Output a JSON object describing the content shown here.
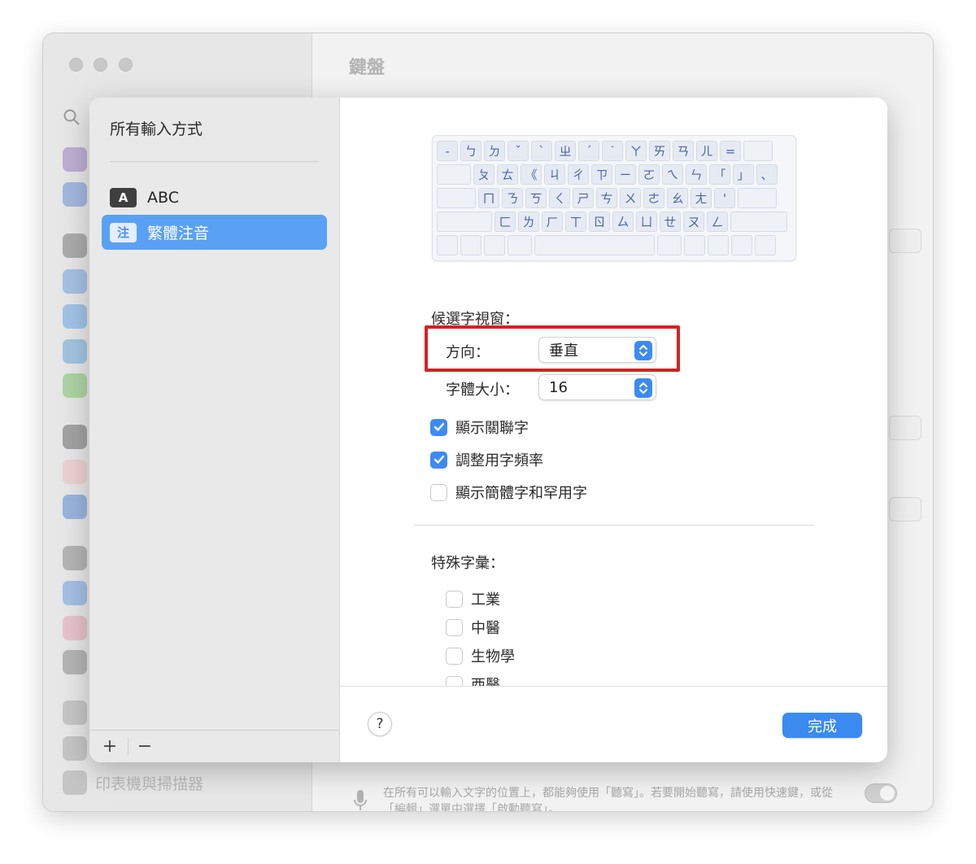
{
  "background_window": {
    "title": "鍵盤",
    "printer_label": "印表機與掃描器",
    "footnote": "在所有可以輸入文字的位置上，都能夠使用「聽寫」。若要開始聽寫，請使用快速鍵，或從「編輯」選單中選擇「啟動聽寫」。"
  },
  "sidebar": {
    "title": "所有輸入方式",
    "items": [
      {
        "badge": "A",
        "label": "ABC",
        "selected": false
      },
      {
        "badge": "注",
        "label": "繁體注音",
        "selected": true
      }
    ],
    "add_label": "+",
    "remove_label": "−"
  },
  "keyboard": {
    "rows": [
      [
        "-",
        "ㄅ",
        "ㄉ",
        "ˇ",
        "ˋ",
        "ㄓ",
        "ˊ",
        "˙",
        "ㄚ",
        "ㄞ",
        "ㄢ",
        "ㄦ",
        "=",
        ""
      ],
      [
        "",
        "ㄆ",
        "ㄊ",
        "《",
        "ㄐ",
        "ㄔ",
        "ㄗ",
        "ㄧ",
        "ㄛ",
        "ㄟ",
        "ㄣ",
        "「",
        "」",
        "、"
      ],
      [
        "",
        "ㄇ",
        "ㄋ",
        "ㄎ",
        "ㄑ",
        "ㄕ",
        "ㄘ",
        "ㄨ",
        "ㄜ",
        "ㄠ",
        "ㄤ",
        "'",
        ""
      ],
      [
        "",
        "ㄈ",
        "ㄌ",
        "ㄏ",
        "ㄒ",
        "ㄖ",
        "ㄙ",
        "ㄩ",
        "ㄝ",
        "ㄡ",
        "ㄥ",
        ""
      ]
    ]
  },
  "candidate_window": {
    "label": "候選字視窗：",
    "orientation_label": "方向：",
    "orientation_value": "垂直",
    "font_size_label": "字體大小：",
    "font_size_value": "16"
  },
  "options": [
    {
      "label": "顯示關聯字",
      "checked": true
    },
    {
      "label": "調整用字頻率",
      "checked": true
    },
    {
      "label": "顯示簡體字和罕用字",
      "checked": false
    }
  ],
  "special_vocab": {
    "label": "特殊字彙：",
    "items": [
      {
        "label": "工業",
        "checked": false
      },
      {
        "label": "中醫",
        "checked": false
      },
      {
        "label": "生物學",
        "checked": false
      },
      {
        "label": "西醫",
        "checked": false
      }
    ]
  },
  "footer": {
    "help_label": "?",
    "done_label": "完成"
  },
  "colors": {
    "accent": "#3d8bf2",
    "selection": "#5aa1f5",
    "highlight_box": "#d32222"
  }
}
